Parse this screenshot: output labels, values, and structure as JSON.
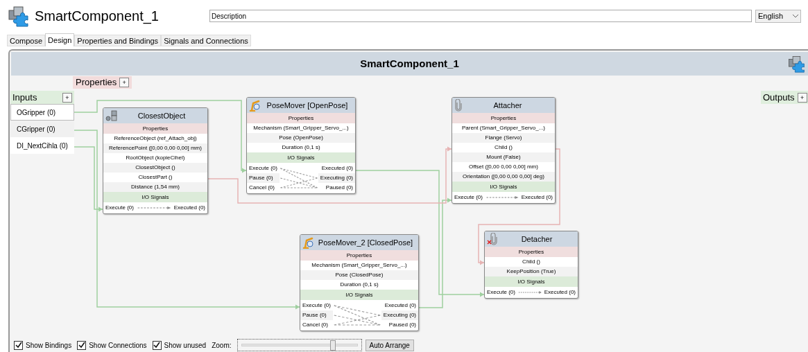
{
  "header": {
    "title": "SmartComponent_1",
    "description": {
      "value": "Description"
    },
    "language": "English"
  },
  "tabs": [
    {
      "label": "Compose",
      "selected": false
    },
    {
      "label": "Design",
      "selected": true
    },
    {
      "label": "Properties and Bindings",
      "selected": false
    },
    {
      "label": "Signals and Connections",
      "selected": false
    }
  ],
  "canvas": {
    "title": "SmartComponent_1",
    "properties": {
      "label": "Properties",
      "add_button": "+"
    },
    "inputs": {
      "label": "Inputs",
      "add_button": "+",
      "items": [
        {
          "label": "OGripper (0)",
          "selected": true
        },
        {
          "label": "CGripper (0)",
          "selected": false
        },
        {
          "label": "DI_NextCihla (0)",
          "selected": false
        }
      ]
    },
    "outputs": {
      "label": "Outputs",
      "add_button": "+"
    },
    "nodes": [
      {
        "title": "ClosestObject",
        "kind": "cubes",
        "properties_header": "Properties",
        "properties": [
          "ReferenceObject (ref_Attach_obj)",
          "ReferencePoint ([0,00 0,00 0,00] mm)",
          "RootObject (kopieCihel)",
          "ClosestObject ()",
          "ClosestPart ()",
          "Distance (1,54 mm)"
        ],
        "signals_header": "I/O Signals",
        "inputs": [
          "Execute (0)"
        ],
        "outputs": [
          "Executed (0)"
        ]
      },
      {
        "title": "PoseMover [OpenPose]",
        "kind": "robot-arm",
        "properties_header": "Properties",
        "properties": [
          "Mechanism (Smart_Gripper_Servo_...)",
          "Pose (OpenPose)",
          "Duration (0,1 s)"
        ],
        "signals_header": "I/O Signals",
        "inputs": [
          "Execute (0)",
          "Pause (0)",
          "Cancel (0)"
        ],
        "outputs": [
          "Executed (0)",
          "Executing (0)",
          "Paused (0)"
        ]
      },
      {
        "title": "Attacher",
        "kind": "paperclip",
        "properties_header": "Properties",
        "properties": [
          "Parent (Smart_Gripper_Servo_...)",
          "Flange (Servo)",
          "Child ()",
          "Mount (False)",
          "Offset ([0,00 0,00 0,00] mm)",
          "Orientation ([0,00 0,00 0,00] deg)"
        ],
        "signals_header": "I/O Signals",
        "inputs": [
          "Execute (0)"
        ],
        "outputs": [
          "Executed (0)"
        ]
      },
      {
        "title": "PoseMover_2 [ClosedPose]",
        "kind": "robot-arm",
        "properties_header": "Properties",
        "properties": [
          "Mechanism (Smart_Gripper_Servo_...)",
          "Pose (ClosedPose)",
          "Duration (0,1 s)"
        ],
        "signals_header": "I/O Signals",
        "inputs": [
          "Execute (0)",
          "Pause (0)",
          "Cancel (0)"
        ],
        "outputs": [
          "Executed (0)",
          "Executing (0)",
          "Paused (0)"
        ]
      },
      {
        "title": "Detacher",
        "kind": "paperclip-remove",
        "properties_header": "Properties",
        "properties": [
          "Child ()",
          "KeepPosition (True)"
        ],
        "signals_header": "I/O Signals",
        "inputs": [
          "Execute (0)"
        ],
        "outputs": [
          "Executed (0)"
        ]
      }
    ]
  },
  "options": [
    {
      "label": "Show Bindings",
      "checked": true
    },
    {
      "label": "Show Connections",
      "checked": true
    },
    {
      "label": "Show unused",
      "checked": true
    }
  ],
  "zoom": {
    "label": "Zoom:",
    "level": 0.79
  },
  "auto_arrange": "Auto Arrange"
}
